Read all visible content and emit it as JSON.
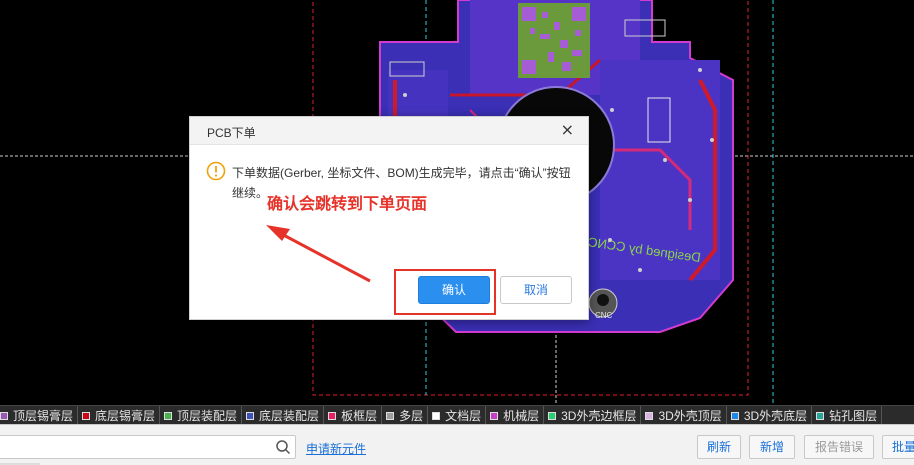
{
  "dialog": {
    "title": "PCB下单",
    "close_glyph": "×",
    "message": "下单数据(Gerber, 坐标文件、BOM)生成完毕，请点击“确认”按钮继续。",
    "annotation": "确认会跳转到下单页面",
    "confirm_label": "确认",
    "cancel_label": "取消",
    "icon": "warning-icon",
    "annotation_color": "#e5332a",
    "primary_color": "#2b8ff0"
  },
  "pcb": {
    "board_text": "Designed by CCNC",
    "silk_text": "CNC"
  },
  "layers": [
    {
      "label": "顶层锡膏层",
      "color": "#9b59b6"
    },
    {
      "label": "底层锡膏层",
      "color": "#d0021b"
    },
    {
      "label": "顶层装配层",
      "color": "#4caf50"
    },
    {
      "label": "底层装配层",
      "color": "#3f51b5"
    },
    {
      "label": "板框层",
      "color": "#e91e63"
    },
    {
      "label": "多层",
      "color": "#9e9e9e"
    },
    {
      "label": "文档层",
      "color": "#ffffff"
    },
    {
      "label": "机械层",
      "color": "#c53fc5"
    },
    {
      "label": "3D外壳边框层",
      "color": "#2ecc71"
    },
    {
      "label": "3D外壳顶层",
      "color": "#d8b4e2"
    },
    {
      "label": "3D外壳底层",
      "color": "#1e88e5"
    },
    {
      "label": "钻孔图层",
      "color": "#26a69a"
    }
  ],
  "toolbar": {
    "search_placeholder": "",
    "search_icon": "search-icon",
    "new_component_link": "申请新元件",
    "refresh_label": "刷新",
    "add_label": "新增",
    "report_label": "报告错误",
    "batch_label": "批量"
  }
}
